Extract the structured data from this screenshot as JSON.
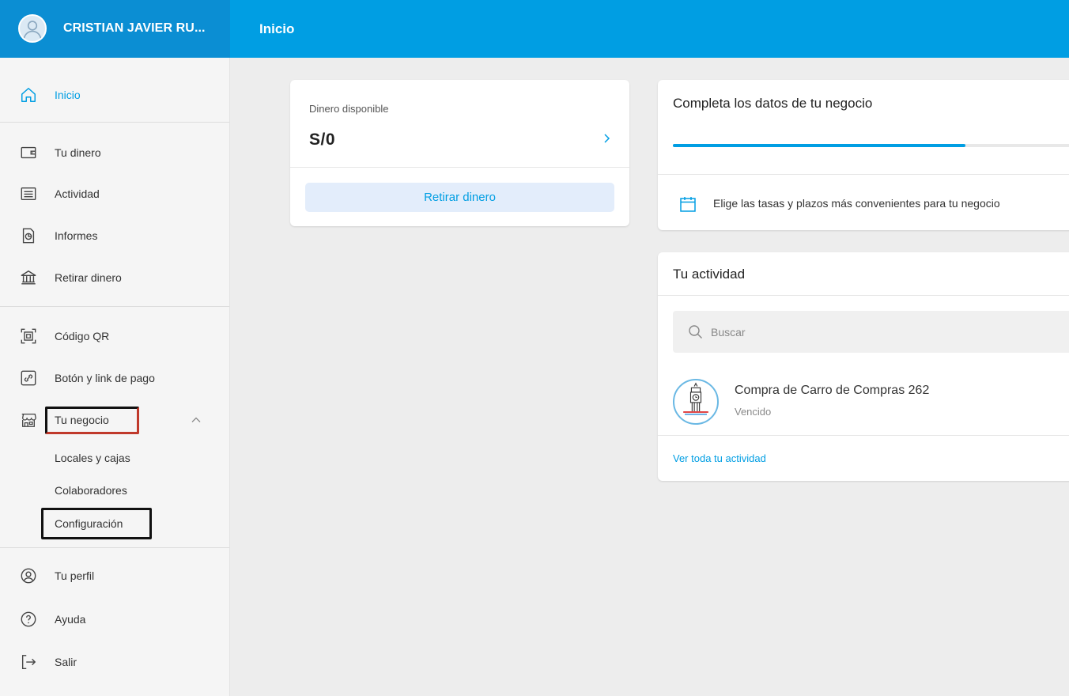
{
  "header": {
    "user_name": "CRISTIAN JAVIER RU...",
    "page_title": "Inicio",
    "brand_color": "#009ee3"
  },
  "sidebar": {
    "items": [
      {
        "label": "Inicio",
        "icon": "home-icon",
        "active": true
      },
      {
        "label": "Tu dinero",
        "icon": "wallet-icon"
      },
      {
        "label": "Actividad",
        "icon": "activity-icon"
      },
      {
        "label": "Informes",
        "icon": "reports-icon"
      },
      {
        "label": "Retirar dinero",
        "icon": "bank-icon"
      },
      {
        "label": "Código QR",
        "icon": "qr-icon"
      },
      {
        "label": "Botón y link de pago",
        "icon": "link-icon"
      },
      {
        "label": "Tu negocio",
        "icon": "store-icon",
        "expanded": true
      },
      {
        "label": "Tu perfil",
        "icon": "user-icon"
      },
      {
        "label": "Ayuda",
        "icon": "help-icon"
      },
      {
        "label": "Salir",
        "icon": "logout-icon"
      }
    ],
    "business_subitems": [
      "Locales y cajas",
      "Colaboradores",
      "Configuración"
    ]
  },
  "money_card": {
    "label": "Dinero disponible",
    "value": "S/0",
    "button": "Retirar dinero"
  },
  "complete_card": {
    "title": "Completa los datos de tu negocio",
    "progress_percent": 71,
    "tip": "Elige las tasas y plazos más convenientes para tu negocio"
  },
  "activity_card": {
    "title": "Tu actividad",
    "search_placeholder": "Buscar",
    "transactions": [
      {
        "title": "Compra de Carro de Compras 262",
        "status": "Vencido"
      }
    ],
    "see_all": "Ver toda tu actividad"
  }
}
